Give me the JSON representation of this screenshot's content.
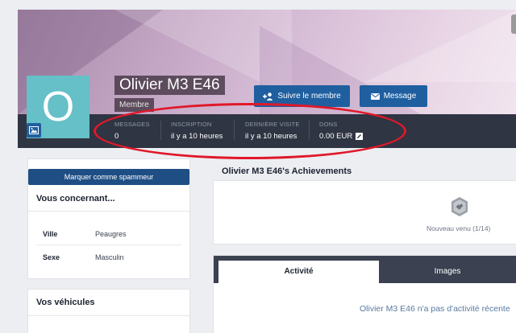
{
  "profile": {
    "name": "Olivier M3 E46",
    "role": "Membre",
    "avatar_letter": "O",
    "avatar_color": "#65c0c7",
    "follow_button": "Suivre le membre",
    "message_button": "Message"
  },
  "stats": [
    {
      "label": "MESSAGES",
      "value": "0"
    },
    {
      "label": "INSCRIPTION",
      "value": "il y a 10 heures"
    },
    {
      "label": "DERNIÈRE VISITE",
      "value": "il y a 10 heures"
    },
    {
      "label": "DONS",
      "value": "0.00 EUR"
    }
  ],
  "sidebar": {
    "spam_button": "Marquer comme spammeur",
    "about_title": "Vous concernant...",
    "fields": [
      {
        "key": "Ville",
        "value": "Peaugres"
      },
      {
        "key": "Sexe",
        "value": "Masculin"
      }
    ],
    "vehicles_title": "Vos véhicules"
  },
  "achievements": {
    "title": "Olivier M3 E46's Achievements",
    "badge_label": "Nouveau venu (1/14)"
  },
  "tabs": {
    "active": "Activité",
    "other": "Images",
    "empty_message": "Olivier M3 E46 n'a pas d'activité récente"
  },
  "colors": {
    "accent": "#1f5fa0",
    "annotation": "#e0182a"
  },
  "icons": {
    "follow": "user-plus-icon",
    "message": "envelope-icon",
    "avatar_edit": "image-icon",
    "donation_edit": "edit-icon",
    "badge": "hexagon-badge-icon"
  }
}
